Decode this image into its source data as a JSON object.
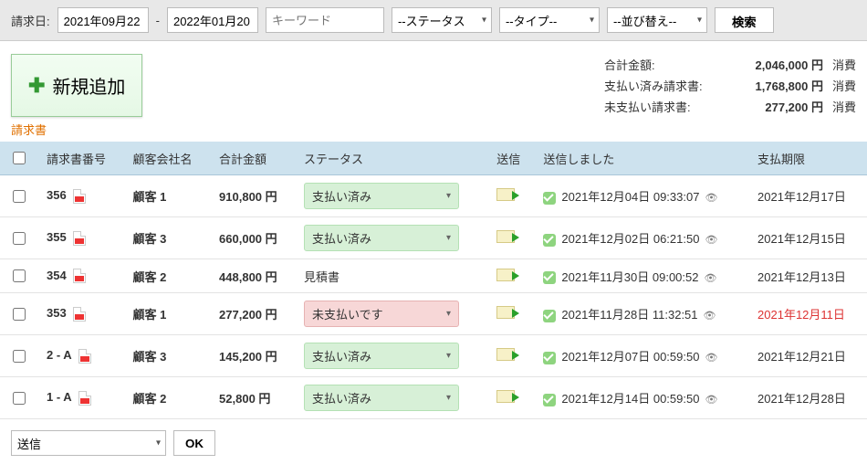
{
  "filter": {
    "label": "請求日:",
    "date_from": "2021年09月22",
    "date_to": "2022年01月20",
    "keyword_placeholder": "キーワード",
    "status_sel": "--ステータス",
    "type_sel": "--タイプ--",
    "sort_sel": "--並び替え--",
    "search": "検索"
  },
  "add_label": "新規追加",
  "summary": {
    "rows": [
      {
        "label": "合計金額:",
        "value": "2,046,000 円",
        "extra": "消費"
      },
      {
        "label": "支払い済み請求書:",
        "value": "1,768,800 円",
        "extra": "消費"
      },
      {
        "label": "未支払い請求書:",
        "value": "277,200 円",
        "extra": "消費"
      }
    ]
  },
  "section_title": "請求書",
  "cols": [
    "",
    "請求書番号",
    "顧客会社名",
    "合計金額",
    "ステータス",
    "送信",
    "送信しました",
    "支払期限"
  ],
  "rows": [
    {
      "no": "356",
      "client": "顧客 1",
      "amount": "910,800 円",
      "status": "支払い済み",
      "status_kind": "paid",
      "sent": "2021年12月04日 09:33:07",
      "due": "2021年12月17日",
      "over": false
    },
    {
      "no": "355",
      "client": "顧客 3",
      "amount": "660,000 円",
      "status": "支払い済み",
      "status_kind": "paid",
      "sent": "2021年12月02日 06:21:50",
      "due": "2021年12月15日",
      "over": false
    },
    {
      "no": "354",
      "client": "顧客 2",
      "amount": "448,800 円",
      "status": "見積書",
      "status_kind": "plain",
      "sent": "2021年11月30日 09:00:52",
      "due": "2021年12月13日",
      "over": false
    },
    {
      "no": "353",
      "client": "顧客 1",
      "amount": "277,200 円",
      "status": "未支払いです",
      "status_kind": "unpaid",
      "sent": "2021年11月28日 11:32:51",
      "due": "2021年12月11日",
      "over": true
    },
    {
      "no": "2 - A",
      "client": "顧客 3",
      "amount": "145,200 円",
      "status": "支払い済み",
      "status_kind": "paid",
      "sent": "2021年12月07日 00:59:50",
      "due": "2021年12月21日",
      "over": false
    },
    {
      "no": "1 - A",
      "client": "顧客 2",
      "amount": "52,800 円",
      "status": "支払い済み",
      "status_kind": "paid",
      "sent": "2021年12月14日 00:59:50",
      "due": "2021年12月28日",
      "over": false
    }
  ],
  "bottom": {
    "action": "送信",
    "ok": "OK"
  }
}
